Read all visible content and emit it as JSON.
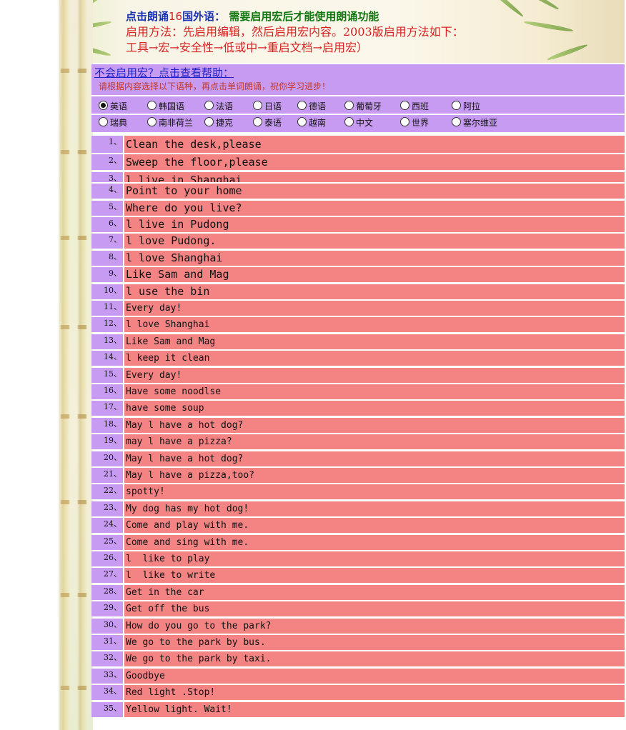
{
  "header": {
    "line1_part1": "点击朗诵",
    "line1_num": "16",
    "line1_part2": "国外语：",
    "line1_part3": "需要启用宏后才能使用朗诵功能",
    "line2": "启用方法：先启用编辑，然后启用宏内容。2003版启用方法如下：",
    "line3": "工具→宏→安全性→低或中→重启文档→启用宏）"
  },
  "help_link": "不会启用宏？点击查看帮助：",
  "instruction": "请根据内容选择以下语种，再点击单词朗诵，祝你学习进步！",
  "languages_row1": [
    {
      "label": "英语",
      "selected": true
    },
    {
      "label": "韩国语",
      "selected": false
    },
    {
      "label": "法语",
      "selected": false
    },
    {
      "label": "日语",
      "selected": false
    },
    {
      "label": "德语",
      "selected": false
    },
    {
      "label": "葡萄牙",
      "selected": false
    },
    {
      "label": "西班",
      "selected": false
    },
    {
      "label": "阿拉",
      "selected": false
    }
  ],
  "languages_row2": [
    {
      "label": "瑞典",
      "selected": false
    },
    {
      "label": "南非荷兰",
      "selected": false
    },
    {
      "label": "捷克",
      "selected": false
    },
    {
      "label": "泰语",
      "selected": false
    },
    {
      "label": "越南",
      "selected": false
    },
    {
      "label": "中文",
      "selected": false
    },
    {
      "label": "世界",
      "selected": false
    },
    {
      "label": "塞尔维亚",
      "selected": false
    }
  ],
  "colors": {
    "purple": "#c79bf2",
    "row_red": "#f48383",
    "title_red": "#d62222",
    "link_blue": "#1d21c8"
  },
  "sentences": [
    {
      "num": "1、",
      "text": "Clean the desk,please"
    },
    {
      "num": "2、",
      "text": "Sweep the floor,please"
    },
    {
      "num": "3、",
      "text": "l live in Shanghai"
    },
    {
      "num": "4、",
      "text": "Point to your home"
    },
    {
      "num": "5、",
      "text": "Where do you live?"
    },
    {
      "num": "6、",
      "text": "l live in Pudong"
    },
    {
      "num": "7、",
      "text": "l love Pudong."
    },
    {
      "num": "8、",
      "text": "l love Shanghai"
    },
    {
      "num": "9、",
      "text": "Like Sam and Mag"
    },
    {
      "num": "10、",
      "text": "l use the bin"
    },
    {
      "num": "11、",
      "text": "Every day!"
    },
    {
      "num": "12、",
      "text": "l love Shanghai"
    },
    {
      "num": "13、",
      "text": "Like Sam and Mag"
    },
    {
      "num": "14、",
      "text": "l keep it clean"
    },
    {
      "num": "15、",
      "text": "Every day!"
    },
    {
      "num": "16、",
      "text": "Have some noodlse"
    },
    {
      "num": "17、",
      "text": "have some soup"
    },
    {
      "num": "18、",
      "text": "May l have a hot dog?"
    },
    {
      "num": "19、",
      "text": "may l have a pizza?"
    },
    {
      "num": "20、",
      "text": "May l have a hot dog?"
    },
    {
      "num": "21、",
      "text": "May l have a pizza,too?"
    },
    {
      "num": "22、",
      "text": "spotty!"
    },
    {
      "num": "23、",
      "text": "My dog has my hot dog!"
    },
    {
      "num": "24、",
      "text": "Come and play with me."
    },
    {
      "num": "25、",
      "text": "Come and sing with me."
    },
    {
      "num": "26、",
      "text": "l  like to play"
    },
    {
      "num": "27、",
      "text": "l  like to write"
    },
    {
      "num": "28、",
      "text": "Get in the car"
    },
    {
      "num": "29、",
      "text": "Get off the bus"
    },
    {
      "num": "30、",
      "text": "How do you go to the park?"
    },
    {
      "num": "31、",
      "text": "We go to the park by bus."
    },
    {
      "num": "32、",
      "text": "We go to the park by taxi."
    },
    {
      "num": "33、",
      "text": "Goodbye"
    },
    {
      "num": "34、",
      "text": "Red light .Stop!"
    },
    {
      "num": "35、",
      "text": "Yellow light. Wait!"
    }
  ]
}
